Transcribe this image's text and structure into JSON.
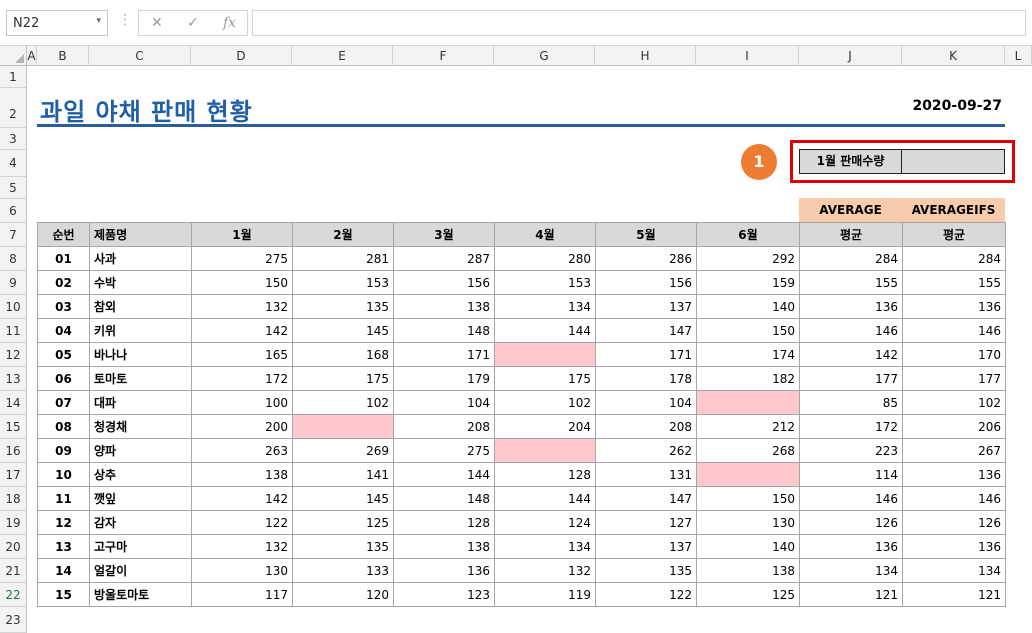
{
  "formula_bar": {
    "name_box": "N22",
    "name_box_arrow": "▾",
    "separator": "⋮",
    "cancel_icon": "✕",
    "enter_icon": "✓",
    "fx_label": "fx",
    "formula": ""
  },
  "column_headers": [
    "A",
    "B",
    "C",
    "D",
    "E",
    "F",
    "G",
    "H",
    "I",
    "J",
    "K",
    "L"
  ],
  "row_headers": [
    "1",
    "2",
    "3",
    "4",
    "5",
    "6",
    "7",
    "8",
    "9",
    "10",
    "11",
    "12",
    "13",
    "14",
    "15",
    "16",
    "17",
    "18",
    "19",
    "20",
    "21",
    "22",
    "23"
  ],
  "active_row": "22",
  "sheet": {
    "title": "과일 야채 판매 현황",
    "date": "2020-09-27",
    "badge": "1",
    "input_label": "1월 판매수량",
    "input_value": "",
    "avg_header_1": "AVERAGE",
    "avg_header_2": "AVERAGEIFS"
  },
  "table": {
    "headers": [
      "순번",
      "제품명",
      "1월",
      "2월",
      "3월",
      "4월",
      "5월",
      "6월",
      "평균",
      "평균"
    ],
    "rows": [
      [
        "01",
        "사과",
        "275",
        "281",
        "287",
        "280",
        "286",
        "292",
        "284",
        "284"
      ],
      [
        "02",
        "수박",
        "150",
        "153",
        "156",
        "153",
        "156",
        "159",
        "155",
        "155"
      ],
      [
        "03",
        "참외",
        "132",
        "135",
        "138",
        "134",
        "137",
        "140",
        "136",
        "136"
      ],
      [
        "04",
        "키위",
        "142",
        "145",
        "148",
        "144",
        "147",
        "150",
        "146",
        "146"
      ],
      [
        "05",
        "바나나",
        "165",
        "168",
        "171",
        "",
        "171",
        "174",
        "142",
        "170"
      ],
      [
        "06",
        "토마토",
        "172",
        "175",
        "179",
        "175",
        "178",
        "182",
        "177",
        "177"
      ],
      [
        "07",
        "대파",
        "100",
        "102",
        "104",
        "102",
        "104",
        "",
        "85",
        "102"
      ],
      [
        "08",
        "청경채",
        "200",
        "",
        "208",
        "204",
        "208",
        "212",
        "172",
        "206"
      ],
      [
        "09",
        "양파",
        "263",
        "269",
        "275",
        "",
        "262",
        "268",
        "223",
        "267"
      ],
      [
        "10",
        "상추",
        "138",
        "141",
        "144",
        "128",
        "131",
        "",
        "114",
        "136"
      ],
      [
        "11",
        "깻잎",
        "142",
        "145",
        "148",
        "144",
        "147",
        "150",
        "146",
        "146"
      ],
      [
        "12",
        "감자",
        "122",
        "125",
        "128",
        "124",
        "127",
        "130",
        "126",
        "126"
      ],
      [
        "13",
        "고구마",
        "132",
        "135",
        "138",
        "134",
        "137",
        "140",
        "136",
        "136"
      ],
      [
        "14",
        "얼갈이",
        "130",
        "133",
        "136",
        "132",
        "135",
        "138",
        "134",
        "134"
      ],
      [
        "15",
        "방울토마토",
        "117",
        "120",
        "123",
        "119",
        "122",
        "125",
        "121",
        "121"
      ]
    ]
  },
  "colors": {
    "title": "#1f5fa8",
    "header_fill": "#d9d9d9",
    "empty_cell_fill": "#ffc7ce",
    "average_header_fill": "#f8cbad",
    "badge": "#ed7d31",
    "highlight_border": "#e00000"
  }
}
